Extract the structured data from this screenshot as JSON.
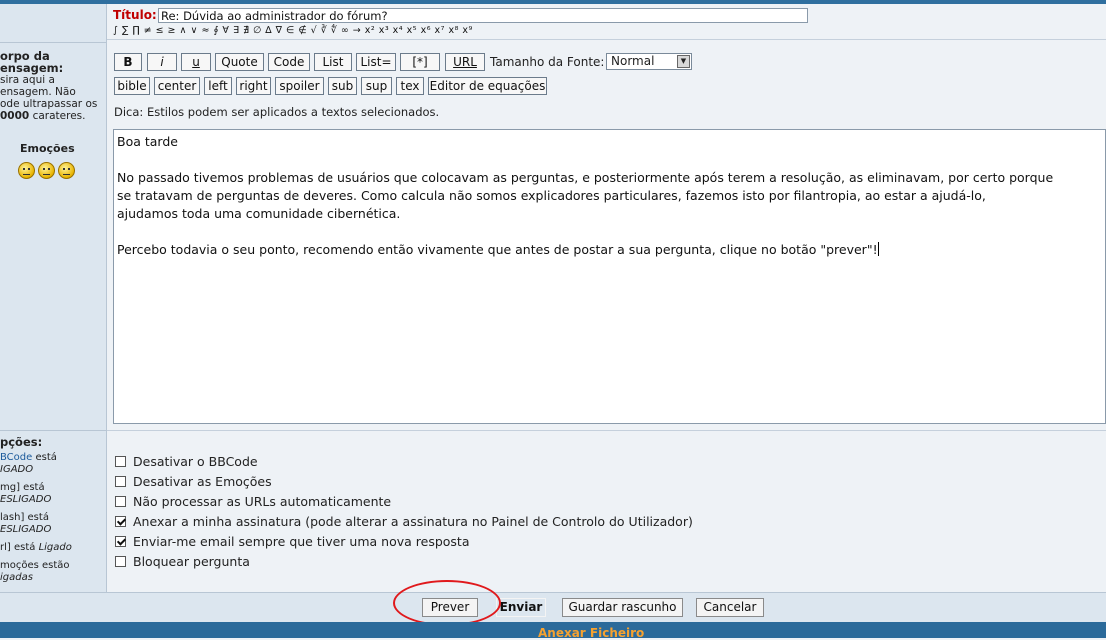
{
  "title_field": {
    "label": "Título:",
    "value": "Re: Dúvida ao administrador do fórum?"
  },
  "symbols": "∫ ∑ ∏ ≠ ≤ ≥ ∧ ∨ ≈ ∮ ∀ ∃ ∄ ∅ ∆ ∇ ∈ ∉ √ ∛ ∜ ∞ → x² x³ x⁴ x⁵ x⁶ x⁷ x⁸ x⁹",
  "left_panel": {
    "body_title_line1": "orpo da",
    "body_title_line2": "ensagem:",
    "body_help_1": "sira aqui a",
    "body_help_2": "ensagem. Não",
    "body_help_3": "ode ultrapassar os",
    "body_help_4_bold": "0000",
    "body_help_4_rest": " carateres.",
    "emoticons_label": "Emoções",
    "options_title": "pções:",
    "opt1_a": "BCode",
    "opt1_b": " está",
    "opt1_c": "IGADO",
    "opt2_a": "mg] está",
    "opt2_b": "ESLIGADO",
    "opt3_a": "lash] está",
    "opt3_b": "ESLIGADO",
    "opt4_a": "rl] está ",
    "opt4_b": "Ligado",
    "opt5_a": "moções estão",
    "opt5_b": "igadas"
  },
  "toolbar": {
    "row1": [
      "B",
      "i",
      "u",
      "Quote",
      "Code",
      "List",
      "List=",
      "[*]",
      "URL"
    ],
    "row2": [
      "bible",
      "center",
      "left",
      "right",
      "spoiler",
      "sub",
      "sup",
      "tex",
      "Editor de equações"
    ],
    "font_size_label": "Tamanho da Fonte:",
    "font_size_value": "Normal"
  },
  "tip": "Dica: Estilos podem ser aplicados a textos selecionados.",
  "message": {
    "line1": "Boa tarde",
    "para2": "No passado tivemos problemas de usuários que colocavam as perguntas, e posteriormente após terem a resolução, as eliminavam, por certo porque\nse tratavam de perguntas de deveres. Como calcula não somos explicadores particulares, fazemos isto por filantropia, ao estar a ajudá-lo,\najudamos toda uma comunidade cibernética.",
    "para3": "Percebo todavia o seu ponto, recomendo então vivamente que antes de postar a sua pergunta, clique no botão \"prever\"!"
  },
  "options": [
    {
      "label": "Desativar o BBCode",
      "checked": false
    },
    {
      "label": "Desativar as Emoções",
      "checked": false
    },
    {
      "label": "Não processar as URLs automaticamente",
      "checked": false
    },
    {
      "label": "Anexar a minha assinatura (pode alterar a assinatura no Painel de Controlo do Utilizador)",
      "checked": true
    },
    {
      "label": "Enviar-me email sempre que tiver uma nova resposta",
      "checked": true
    },
    {
      "label": "Bloquear pergunta",
      "checked": false
    }
  ],
  "actions": {
    "preview": "Prever",
    "submit": "Enviar",
    "save_draft": "Guardar rascunho",
    "cancel": "Cancelar"
  },
  "attach_label": "Anexar Ficheiro"
}
